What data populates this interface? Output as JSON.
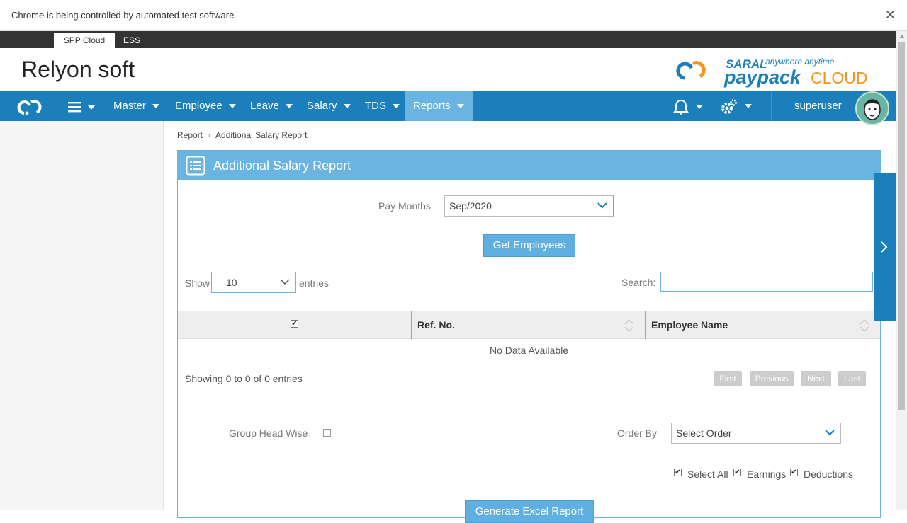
{
  "infobar": {
    "message": "Chrome is being controlled by automated test software.",
    "close": "✕"
  },
  "apptabs": {
    "active": "SPP Cloud",
    "inactive": "ESS"
  },
  "header": {
    "company": "Relyon soft"
  },
  "nav": {
    "items": [
      "Master",
      "Employee",
      "Leave",
      "Salary",
      "TDS",
      "Reports"
    ],
    "active": "Reports",
    "user": "superuser"
  },
  "breadcrumb": {
    "root": "Report",
    "current": "Additional Salary Report"
  },
  "panel": {
    "title": "Additional Salary Report",
    "pay_months_label": "Pay Months",
    "pay_months_value": "Sep/2020",
    "get_employees": "Get Employees",
    "show_label": "Show",
    "entries_value": "10",
    "entries_label": "entries",
    "search_label": "Search:",
    "search_value": "",
    "columns": [
      "Ref. No.",
      "Employee Name"
    ],
    "no_data": "No Data Available",
    "showing": "Showing 0 to 0 of 0 entries",
    "pager": [
      "First",
      "Previous",
      "Next",
      "Last"
    ],
    "group_head_label": "Group Head Wise",
    "order_by_label": "Order By",
    "order_by_value": "Select Order",
    "select_all": "Select All",
    "earnings": "Earnings",
    "deductions": "Deductions",
    "generate_button": "Generate Excel Report"
  },
  "colors": {
    "primary": "#1b7fbc",
    "accent": "#6ab4e2",
    "button": "#5fb0e0"
  }
}
